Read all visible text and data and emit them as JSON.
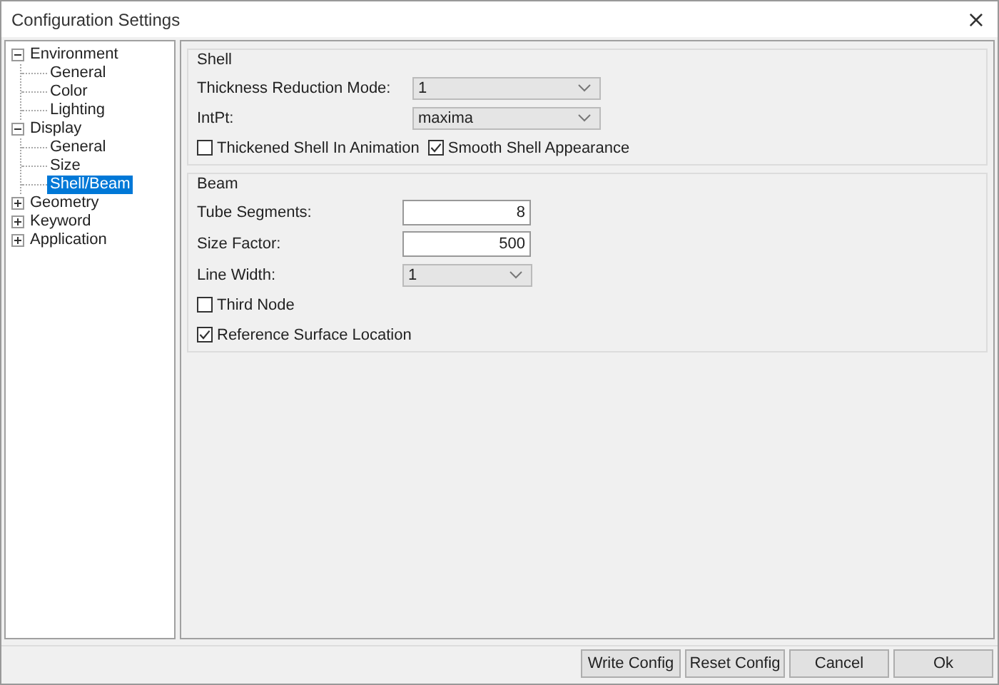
{
  "window": {
    "title": "Configuration Settings",
    "close": "×"
  },
  "tree": [
    {
      "label": "Environment",
      "expanded": true,
      "selected": false,
      "children": [
        {
          "label": "General",
          "selected": false
        },
        {
          "label": "Color",
          "selected": false
        },
        {
          "label": "Lighting",
          "selected": false
        }
      ]
    },
    {
      "label": "Display",
      "expanded": true,
      "selected": false,
      "children": [
        {
          "label": "General",
          "selected": false
        },
        {
          "label": "Size",
          "selected": false
        },
        {
          "label": "Shell/Beam",
          "selected": true
        }
      ]
    },
    {
      "label": "Geometry",
      "expanded": false,
      "selected": false
    },
    {
      "label": "Keyword",
      "expanded": false,
      "selected": false
    },
    {
      "label": "Application",
      "expanded": false,
      "selected": false
    }
  ],
  "groups": [
    {
      "title": "Shell",
      "kind": "wide",
      "rows": [
        {
          "kind": "dropdown",
          "label": "Thickness Reduction Mode:",
          "value": "1"
        },
        {
          "kind": "dropdown",
          "label": "IntPt:",
          "value": "maxima"
        },
        {
          "kind": "checkpair",
          "items": [
            {
              "label": "Thickened Shell In Animation",
              "checked": false
            },
            {
              "label": "Smooth Shell Appearance",
              "checked": true
            }
          ]
        }
      ]
    },
    {
      "title": "Beam",
      "kind": "narrow",
      "rows": [
        {
          "kind": "input",
          "label": "Tube Segments:",
          "value": "8"
        },
        {
          "kind": "input",
          "label": "Size Factor:",
          "value": "500"
        },
        {
          "kind": "dropdown",
          "label": "Line Width:",
          "value": "1"
        },
        {
          "kind": "checkbox",
          "label": "Third Node",
          "checked": false
        },
        {
          "kind": "checkbox",
          "label": "Reference Surface Location",
          "checked": true
        }
      ]
    }
  ],
  "buttons": [
    "Write Config",
    "Reset Config",
    "Cancel",
    "Ok"
  ]
}
